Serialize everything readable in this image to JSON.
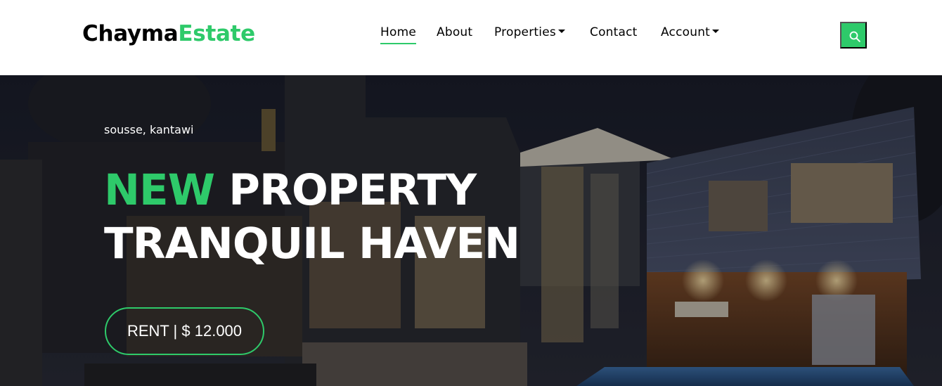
{
  "brand": {
    "part1": "Chayma",
    "part2": "Estate"
  },
  "nav": {
    "home": "Home",
    "about": "About",
    "properties": "Properties",
    "contact": "Contact",
    "account": "Account"
  },
  "search": {
    "icon": "search-icon"
  },
  "hero": {
    "location": "sousse, kantawi",
    "headline_accent": "NEW",
    "headline_rest": "PROPERTY",
    "headline_line2": "TRANQUIL HAVEN",
    "price_label": "RENT | $ 12.000"
  },
  "colors": {
    "accent": "#2eca6a",
    "text": "#000000",
    "hero_text": "#ffffff"
  }
}
